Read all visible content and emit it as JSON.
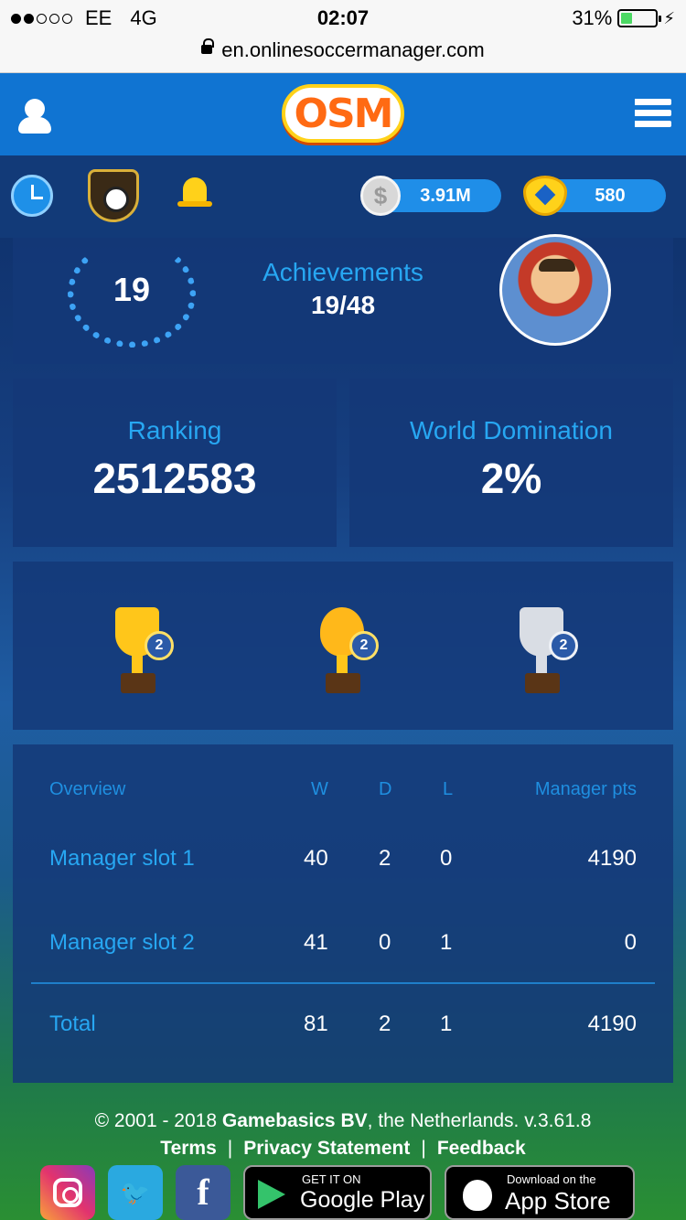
{
  "status_bar": {
    "carrier": "EE",
    "network": "4G",
    "time": "02:07",
    "battery": "31%",
    "signal_bars": 2,
    "battery_level": 0.31
  },
  "browser": {
    "url": "en.onlinesoccermanager.com"
  },
  "header": {
    "logo_text": "OSM"
  },
  "toolbar": {
    "silver_coins": "3.91M",
    "gold_coins": "580",
    "coin_symbol": "$"
  },
  "achievements": {
    "count": "19",
    "title": "Achievements",
    "progress": "19/48"
  },
  "ranking": {
    "title": "Ranking",
    "value": "2512583"
  },
  "world_domination": {
    "title": "World Domination",
    "value": "2%"
  },
  "trophies": [
    {
      "type": "gold-cup",
      "count": "2"
    },
    {
      "type": "golden-ball",
      "count": "2"
    },
    {
      "type": "silver-cup",
      "count": "2"
    }
  ],
  "table": {
    "headers": [
      "Overview",
      "W",
      "D",
      "L",
      "Manager pts"
    ],
    "rows": [
      {
        "label": "Manager slot 1",
        "w": "40",
        "d": "2",
        "l": "0",
        "pts": "4190"
      },
      {
        "label": "Manager slot 2",
        "w": "41",
        "d": "0",
        "l": "1",
        "pts": "0"
      }
    ],
    "total": {
      "label": "Total",
      "w": "81",
      "d": "2",
      "l": "1",
      "pts": "4190"
    }
  },
  "footer": {
    "copyright_prefix": "© 2001 - 2018 ",
    "company": "Gamebasics BV",
    "copyright_suffix": ", the Netherlands. v.3.61.8",
    "links": [
      "Terms",
      "Privacy Statement",
      "Feedback"
    ],
    "separator": "|",
    "social": [
      "instagram",
      "twitter",
      "facebook"
    ],
    "facebook_glyph": "f",
    "twitter_glyph": "🐦",
    "google_play": {
      "small": "GET IT ON",
      "big": "Google Play"
    },
    "app_store": {
      "small": "Download on the",
      "big": "App Store"
    }
  },
  "colors": {
    "header_blue": "#1074d2",
    "accent_text": "#27a7f2",
    "panel_bg": "#143878"
  }
}
